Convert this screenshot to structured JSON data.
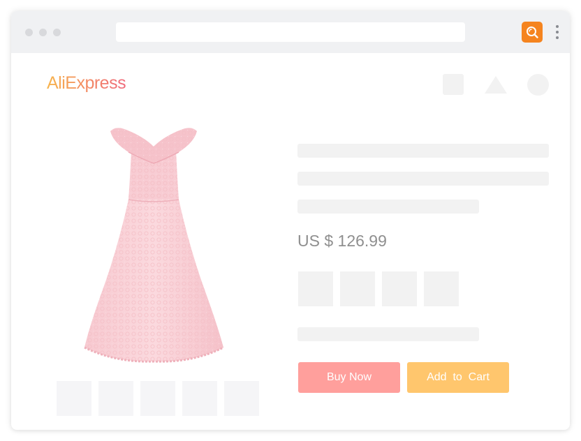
{
  "browser": {
    "extension_icon": "search-icon",
    "menu_icon": "more-vertical-icon",
    "accent": "#f5841f"
  },
  "header": {
    "logo_text": "AliExpress",
    "nav_icons": [
      "square-icon",
      "triangle-icon",
      "circle-icon"
    ]
  },
  "product": {
    "image": "pink-lace-off-shoulder-dress",
    "price": "US $ 126.99",
    "actions": {
      "buy_now_label": "Buy Now",
      "add_to_cart_label": "Add  to  Cart",
      "buy_color": "#ff9f9c",
      "cart_color": "#ffc66d"
    }
  }
}
